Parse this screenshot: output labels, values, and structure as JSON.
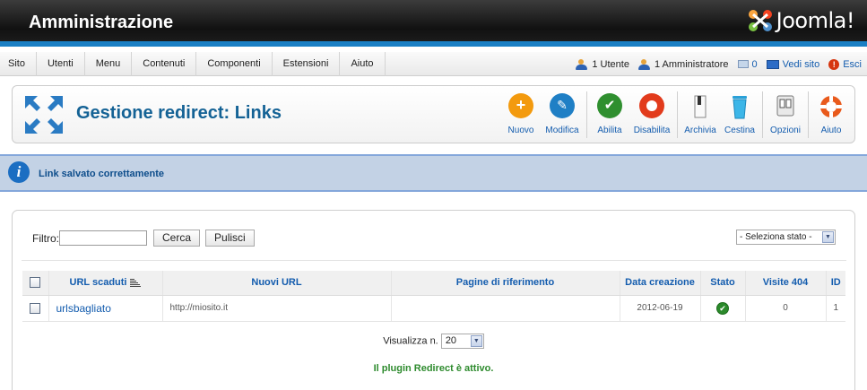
{
  "header": {
    "title": "Amministrazione",
    "logo_text": "Joomla!"
  },
  "menu": [
    "Sito",
    "Utenti",
    "Menu",
    "Contenuti",
    "Componenti",
    "Estensioni",
    "Aiuto"
  ],
  "status": {
    "users": "1 Utente",
    "admins": "1 Amministratore",
    "messages": "0",
    "view_site": "Vedi sito",
    "logout": "Esci"
  },
  "toolbar": {
    "title": "Gestione redirect: Links",
    "buttons": [
      {
        "id": "new",
        "label": "Nuovo",
        "icon": "plus-icon",
        "color": "#f39a0e"
      },
      {
        "id": "edit",
        "label": "Modifica",
        "icon": "pencil-icon",
        "color": "#1f7fc5"
      },
      {
        "id": "publish",
        "label": "Abilita",
        "icon": "check-icon",
        "color": "#2f8f2f"
      },
      {
        "id": "unpublish",
        "label": "Disabilita",
        "icon": "circle-off-icon",
        "color": "#e23b1c"
      },
      {
        "id": "archive",
        "label": "Archivia",
        "icon": "archive-icon"
      },
      {
        "id": "trash",
        "label": "Cestina",
        "icon": "trash-icon"
      },
      {
        "id": "options",
        "label": "Opzioni",
        "icon": "options-icon"
      },
      {
        "id": "help",
        "label": "Aiuto",
        "icon": "lifebuoy-icon"
      }
    ]
  },
  "message": {
    "text": "Link salvato correttamente"
  },
  "filter": {
    "label": "Filtro:",
    "value": "",
    "search_button": "Cerca",
    "clear_button": "Pulisci",
    "state_select": "- Seleziona stato -"
  },
  "table": {
    "headers": {
      "old_url": "URL scaduti",
      "new_url": "Nuovi URL",
      "referer": "Pagine di riferimento",
      "created": "Data creazione",
      "state": "Stato",
      "hits": "Visite 404",
      "id": "ID"
    },
    "rows": [
      {
        "old_url": "urlsbagliato",
        "new_url": "http://miosito.it",
        "referer": "",
        "created": "2012-06-19",
        "state": "enabled",
        "hits": "0",
        "id": "1"
      }
    ]
  },
  "pagination": {
    "label": "Visualizza n.",
    "value": "20"
  },
  "plugin_message": "Il plugin Redirect è attivo."
}
